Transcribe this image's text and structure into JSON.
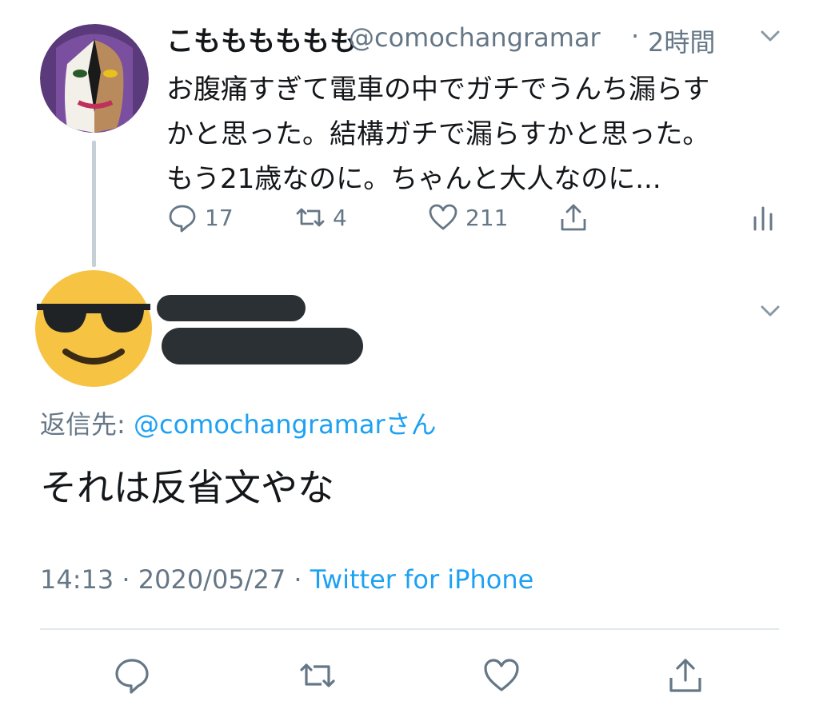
{
  "parent_tweet": {
    "display_name": "こもももももも",
    "handle": "@comochangramar",
    "separator": "·",
    "time": "2時間",
    "text_lines": [
      "お腹痛すぎて電車の中でガチでうんち漏らす",
      "かと思った。結構ガチで漏らすかと思った。",
      "もう21歳なのに。ちゃんと大人なのに..."
    ],
    "reply_count": "17",
    "retweet_count": "4",
    "like_count": "211",
    "icons": [
      "reply-icon",
      "retweet-icon",
      "like-icon",
      "share-icon",
      "analytics-icon",
      "chevron-down-icon"
    ]
  },
  "reply_tweet": {
    "replying_to_label": "返信先:",
    "replying_to_handle": "@comochangramarさん",
    "text": "それは反省文やな",
    "time": "14:13",
    "date": "2020/05/27",
    "separator": "·",
    "source": "Twitter for iPhone",
    "avatar_icon": "sunglasses-emoji-avatar"
  },
  "colors": {
    "text_primary": "#14171a",
    "text_secondary": "#657786",
    "link_blue": "#1da1f2",
    "thread_line": "#c4cfd6",
    "divider": "#e1e8ed"
  }
}
